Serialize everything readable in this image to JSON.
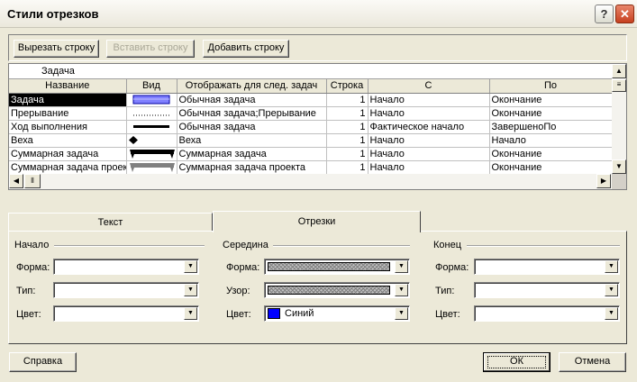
{
  "window": {
    "title": "Стили отрезков",
    "help_glyph": "?",
    "close_glyph": "✕"
  },
  "toolbar": {
    "cut_row": "Вырезать строку",
    "paste_row": "Вставить строку",
    "add_row": "Добавить строку"
  },
  "grid": {
    "edit_value": "Задача",
    "columns": [
      "Название",
      "Вид",
      "Отображать для след. задач",
      "Строка",
      "С",
      "По"
    ],
    "rows": [
      {
        "name": "Задача",
        "appearance": "task-bar",
        "show_for": "Обычная задача",
        "row": "1",
        "from": "Начало",
        "to": "Окончание"
      },
      {
        "name": "Прерывание",
        "appearance": "split-dotted",
        "show_for": "Обычная задача;Прерывание",
        "row": "1",
        "from": "Начало",
        "to": "Окончание"
      },
      {
        "name": "Ход выполнения",
        "appearance": "progress-line",
        "show_for": "Обычная задача",
        "row": "1",
        "from": "Фактическое начало",
        "to": "ЗавершеноПо"
      },
      {
        "name": "Веха",
        "appearance": "milestone-diamond",
        "show_for": "Веха",
        "row": "1",
        "from": "Начало",
        "to": "Начало"
      },
      {
        "name": "Суммарная задача",
        "appearance": "summary-bar",
        "show_for": "Суммарная задача",
        "row": "1",
        "from": "Начало",
        "to": "Окончание"
      },
      {
        "name": "Суммарная задача проекта",
        "appearance": "project-summary-bar",
        "show_for": "Суммарная задача проекта",
        "row": "1",
        "from": "Начало",
        "to": "Окончание"
      }
    ]
  },
  "tabs": {
    "text": "Текст",
    "bars": "Отрезки"
  },
  "groups": {
    "start": {
      "title": "Начало",
      "shape_label": "Форма:",
      "type_label": "Тип:",
      "color_label": "Цвет:",
      "shape_value": "",
      "type_value": "",
      "color_value": ""
    },
    "middle": {
      "title": "Середина",
      "shape_label": "Форма:",
      "pattern_label": "Узор:",
      "color_label": "Цвет:",
      "color_value": "Синий",
      "color_hex": "#0000ff"
    },
    "end": {
      "title": "Конец",
      "shape_label": "Форма:",
      "type_label": "Тип:",
      "color_label": "Цвет:",
      "shape_value": "",
      "type_value": "",
      "color_value": ""
    }
  },
  "buttons": {
    "help": "Справка",
    "ok": "ОК",
    "cancel": "Отмена"
  },
  "colors": {
    "dialog_bg": "#ece9d8",
    "close_button": "#c6401f",
    "task_bar": "#8080ff",
    "middle_color": "#0000ff"
  }
}
